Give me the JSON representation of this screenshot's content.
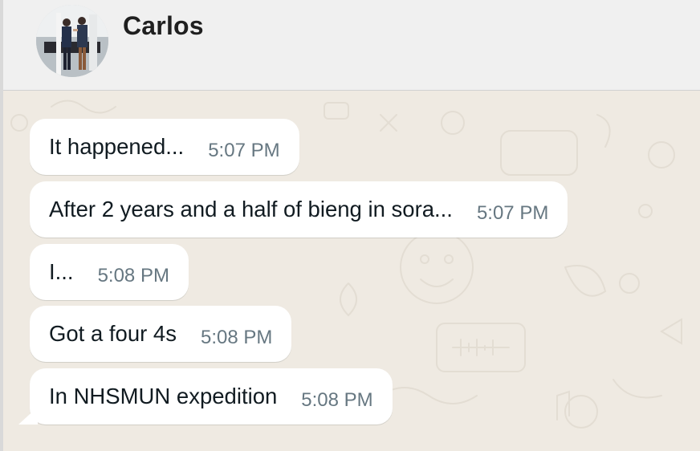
{
  "contact": {
    "name": "Carlos",
    "avatar": "profile-photo"
  },
  "messages": [
    {
      "text": "It happened...",
      "time": "5:07 PM"
    },
    {
      "text": "After 2 years and a half of bieng in sora...",
      "time": "5:07 PM"
    },
    {
      "text": "I...",
      "time": "5:08 PM"
    },
    {
      "text": "Got a four 4s",
      "time": "5:08 PM"
    },
    {
      "text": "In NHSMUN expedition",
      "time": "5:08 PM"
    }
  ],
  "colors": {
    "chat_background": "#efeae2",
    "header_background": "#f0f0f0",
    "bubble_background": "#ffffff",
    "message_text": "#111b21",
    "timestamp_text": "#667781"
  }
}
